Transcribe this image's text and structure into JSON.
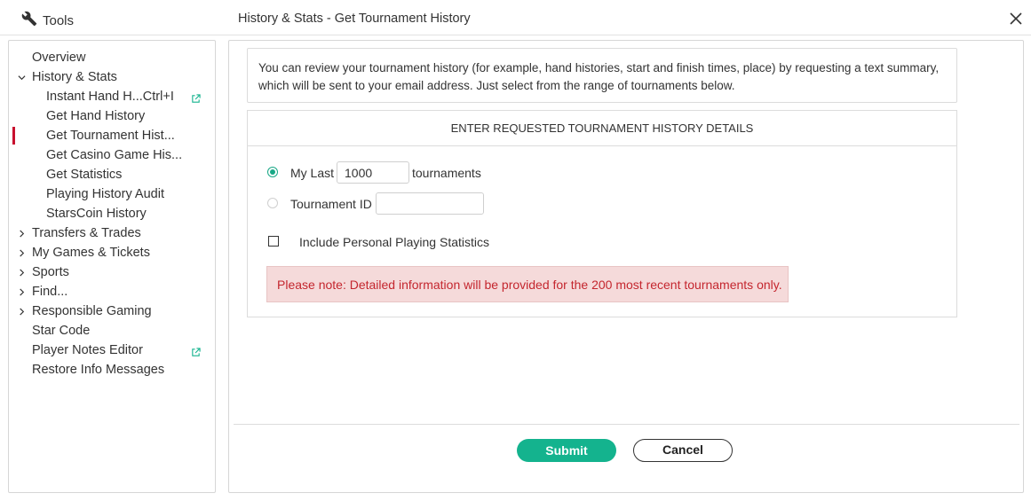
{
  "header": {
    "tools_label": "Tools",
    "window_title": "History & Stats - Get Tournament History"
  },
  "sidebar": {
    "items": [
      {
        "label": "Overview"
      },
      {
        "label": "History & Stats",
        "expanded": true
      },
      {
        "label": "Instant Hand H...Ctrl+I",
        "external": true
      },
      {
        "label": "Get Hand History"
      },
      {
        "label": "Get Tournament Hist...",
        "active": true
      },
      {
        "label": "Get Casino Game His..."
      },
      {
        "label": "Get Statistics"
      },
      {
        "label": "Playing History Audit"
      },
      {
        "label": "StarsCoin History"
      },
      {
        "label": "Transfers & Trades",
        "expandable": true
      },
      {
        "label": "My Games & Tickets",
        "expandable": true
      },
      {
        "label": "Sports",
        "expandable": true
      },
      {
        "label": "Find...",
        "expandable": true
      },
      {
        "label": "Responsible Gaming",
        "expandable": true
      },
      {
        "label": "Star Code"
      },
      {
        "label": "Player Notes Editor",
        "external": true
      },
      {
        "label": "Restore Info Messages"
      }
    ]
  },
  "main": {
    "info_text": "You can review your tournament history (for example, hand histories, start and finish times, place) by requesting a text summary, which will be sent to your email address. Just select from the range of tournaments below.",
    "form_header": "ENTER REQUESTED TOURNAMENT HISTORY DETAILS",
    "my_last_label": "My Last",
    "my_last_value": "1000",
    "tournaments_label": "tournaments",
    "tournament_id_label": "Tournament ID",
    "tournament_id_value": "",
    "include_stats_label": "Include Personal Playing Statistics",
    "notice_text": "Please note: Detailed information will be provided for the 200 most recent tournaments only.",
    "submit_label": "Submit",
    "cancel_label": "Cancel"
  },
  "colors": {
    "accent_green": "#14b38e",
    "active_marker": "#c8102e",
    "notice_bg": "#f5dada",
    "notice_text": "#c4262e"
  }
}
